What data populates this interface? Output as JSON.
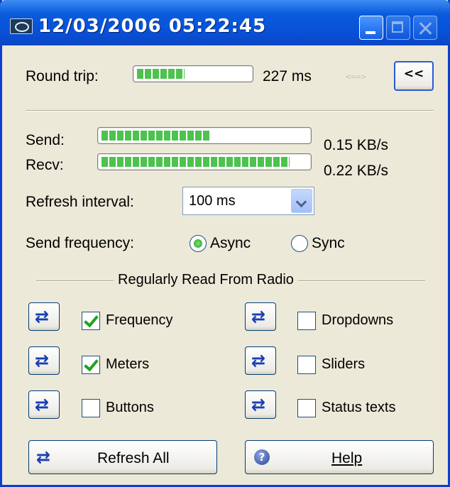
{
  "window": {
    "title": "12/03/2006 05:22:45"
  },
  "round_trip": {
    "label": "Round trip:",
    "level_percent": 43,
    "value": "227 ms",
    "arrows_glyph": "<==>",
    "collapse_label": "<<"
  },
  "send": {
    "label": "Send:",
    "level_percent": 53,
    "value": "0.15 KB/s"
  },
  "recv": {
    "label": "Recv:",
    "level_percent": 92,
    "value": "0.22 KB/s"
  },
  "refresh_interval": {
    "label": "Refresh interval:",
    "value": "100 ms"
  },
  "send_frequency": {
    "label": "Send frequency:",
    "options": [
      {
        "label": "Async",
        "selected": true
      },
      {
        "label": "Sync",
        "selected": false
      }
    ]
  },
  "regular_read": {
    "title": "Regularly Read From Radio",
    "items": [
      {
        "label": "Frequency",
        "checked": true
      },
      {
        "label": "Meters",
        "checked": true
      },
      {
        "label": "Buttons",
        "checked": false
      },
      {
        "label": "Dropdowns",
        "checked": false
      },
      {
        "label": "Sliders",
        "checked": false
      },
      {
        "label": "Status texts",
        "checked": false
      }
    ]
  },
  "footer": {
    "refresh_all_label": "Refresh All",
    "help_label": "Help"
  },
  "icons": {
    "app": "remote-control-app-icon",
    "refresh": "refresh-icon",
    "help": "help-icon"
  },
  "colors": {
    "titlebar": "#0a5bdc",
    "window_bg": "#ece9d8",
    "progress_green": "#4ec24e",
    "refresh_blue": "#1a3fb0"
  }
}
